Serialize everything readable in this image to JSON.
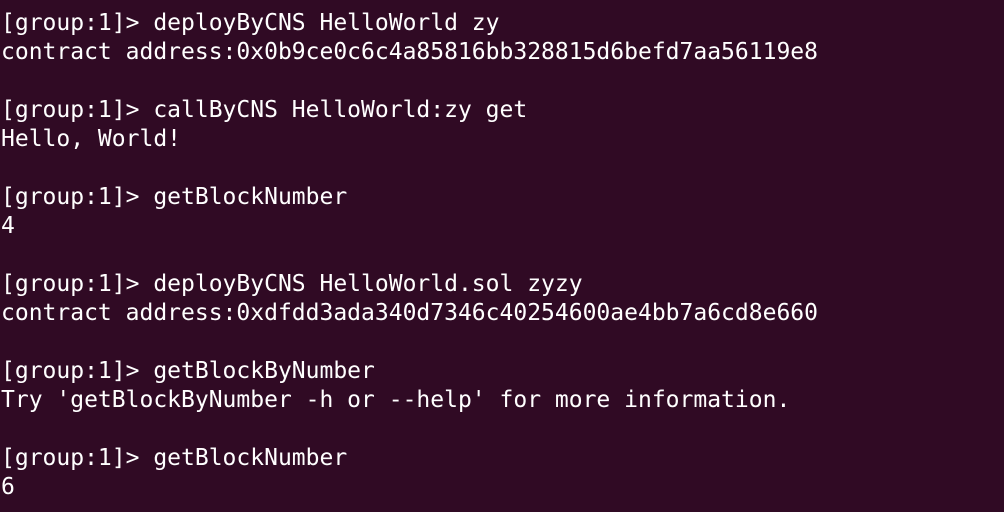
{
  "terminal": {
    "lines": [
      "[group:1]> deployByCNS HelloWorld zy",
      "contract address:0x0b9ce0c6c4a85816bb328815d6befd7aa56119e8",
      "",
      "[group:1]> callByCNS HelloWorld:zy get",
      "Hello, World!",
      "",
      "[group:1]> getBlockNumber",
      "4",
      "",
      "[group:1]> deployByCNS HelloWorld.sol zyzy",
      "contract address:0xdfdd3ada340d7346c40254600ae4bb7a6cd8e660",
      "",
      "[group:1]> getBlockByNumber",
      "Try 'getBlockByNumber -h or --help' for more information.",
      "",
      "[group:1]> getBlockNumber",
      "6"
    ]
  },
  "colors": {
    "background": "#300a24",
    "foreground": "#ffffff"
  }
}
